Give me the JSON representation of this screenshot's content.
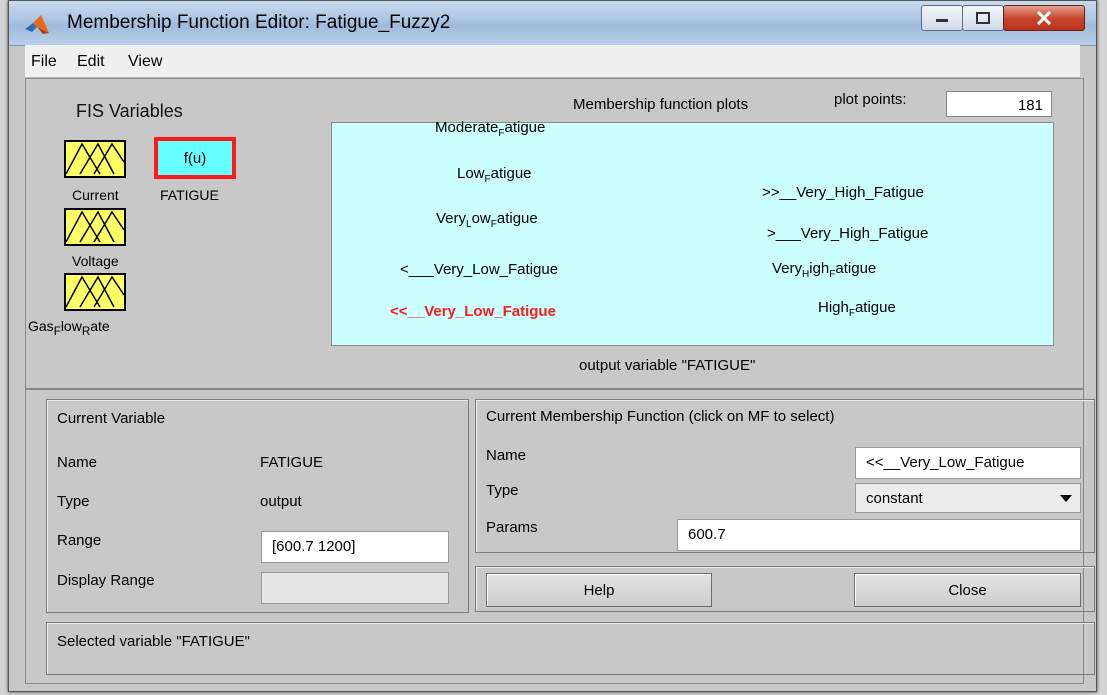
{
  "window": {
    "title": "Membership Function Editor: Fatigue_Fuzzy2",
    "controls": [
      "minimize",
      "maximize",
      "close"
    ]
  },
  "menu": [
    "File",
    "Edit",
    "View"
  ],
  "fis_panel": {
    "title": "FIS Variables",
    "inputs": [
      {
        "label_main": "Current",
        "icon": "mf-triangle-icon"
      },
      {
        "label_main": "Voltage",
        "icon": "mf-triangle-icon"
      },
      {
        "label_main": "Gas",
        "sub1": "F",
        "mid": "low",
        "sub2": "R",
        "tail": "ate",
        "icon": "mf-triangle-icon"
      }
    ],
    "output": {
      "box_label": "f(u)",
      "name": "FATIGUE"
    }
  },
  "plot": {
    "header": "Membership function plots",
    "plot_points_label": "plot points:",
    "plot_points_value": "181",
    "output_caption": "output variable \"FATIGUE\"",
    "mfs": [
      {
        "a": "Moderate",
        "sub": "F",
        "b": "atigue"
      },
      {
        "a": "Low",
        "sub": "F",
        "b": "atigue"
      },
      {
        "a": "Very",
        "sub": "L",
        "b": "ow",
        "sub2": "F",
        "c": "atigue"
      },
      {
        "a": "<___Very_Low_Fatigue"
      },
      {
        "a": "<<__Very_Low_Fatigue",
        "selected": true
      },
      {
        "a": ">>__Very_High_Fatigue"
      },
      {
        "a": ">___Very_High_Fatigue"
      },
      {
        "a": "Very",
        "sub": "H",
        "b": "igh",
        "sub2": "F",
        "c": "atigue"
      },
      {
        "a": "High",
        "sub": "F",
        "b": "atigue"
      }
    ]
  },
  "current_variable": {
    "title": "Current Variable",
    "name_label": "Name",
    "name_value": "FATIGUE",
    "type_label": "Type",
    "type_value": "output",
    "range_label": "Range",
    "range_value": "[600.7 1200]",
    "display_range_label": "Display Range",
    "display_range_value": ""
  },
  "current_mf": {
    "title": "Current Membership Function (click on MF to select)",
    "name_label": "Name",
    "name_value": "<<__Very_Low_Fatigue",
    "type_label": "Type",
    "type_value": "constant",
    "params_label": "Params",
    "params_value": "600.7"
  },
  "buttons": {
    "help": "Help",
    "close": "Close"
  },
  "status": "Selected variable \"FATIGUE\"",
  "colors": {
    "plot_bg": "#ccffff",
    "input_icon": "#ffff66",
    "output_box": "#66ffff",
    "selected": "#ff1a1a"
  }
}
